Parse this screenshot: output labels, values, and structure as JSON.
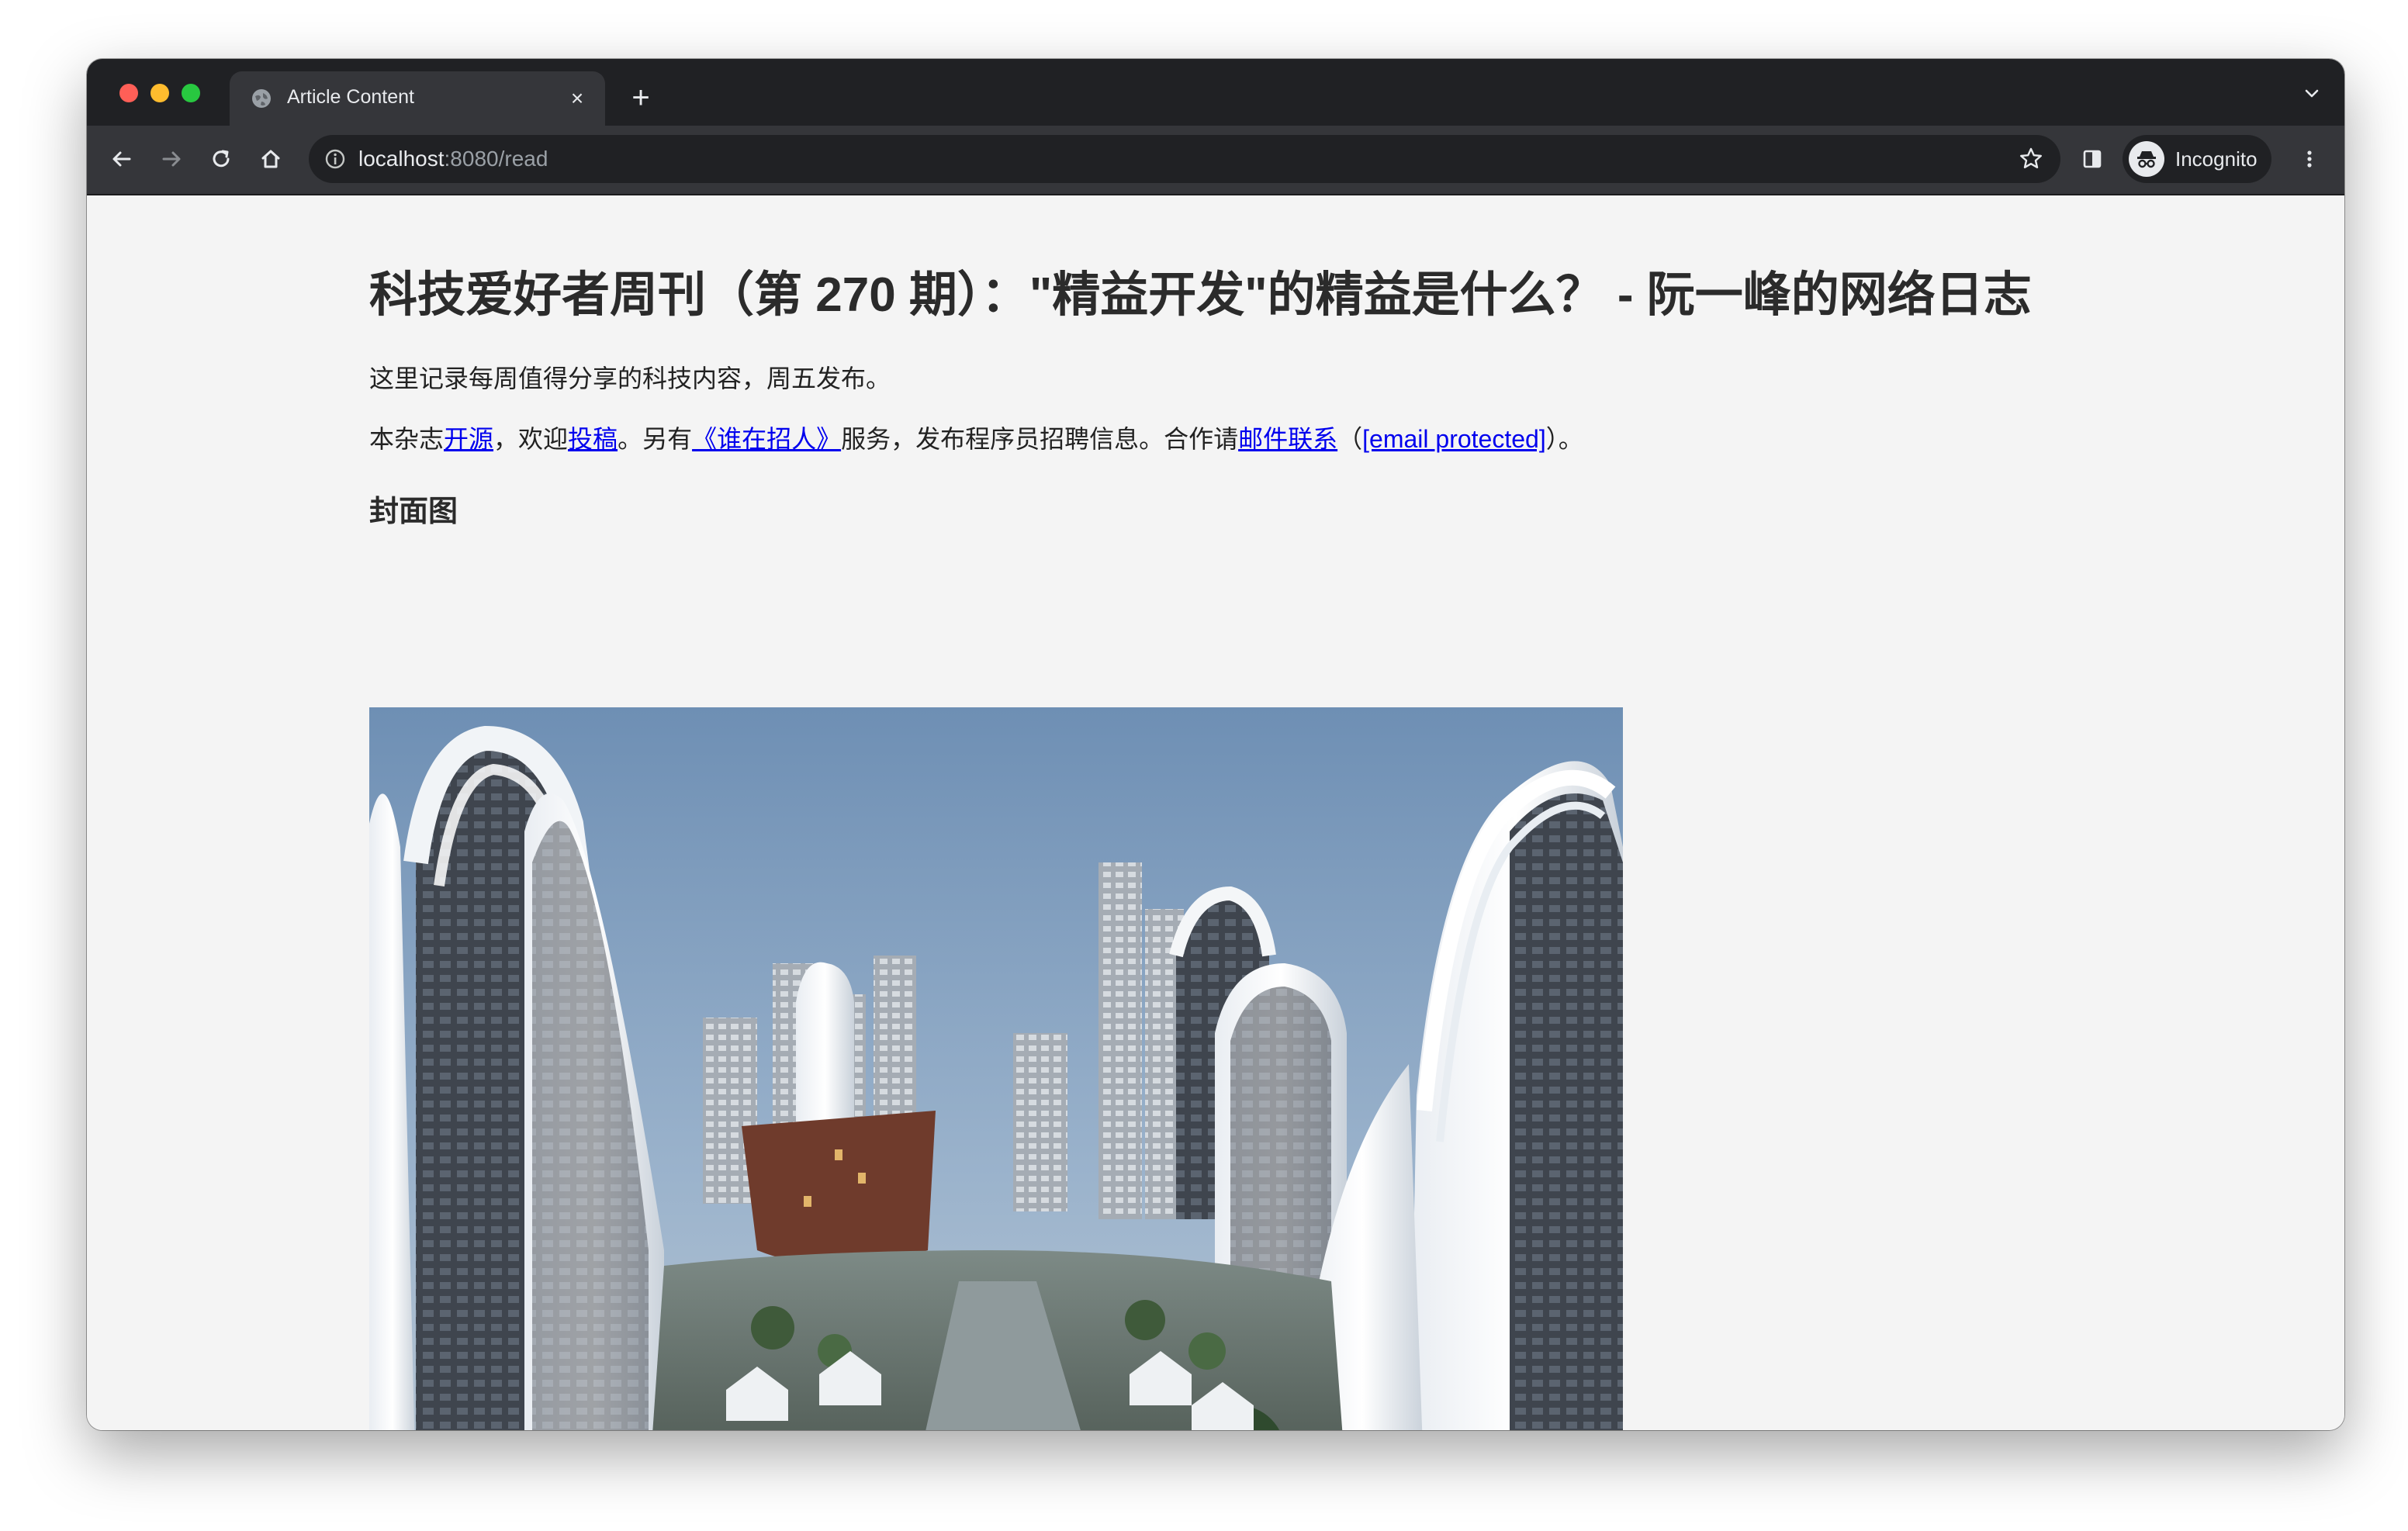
{
  "browser": {
    "tab_title": "Article Content",
    "tab_close_label": "×",
    "new_tab_label": "+",
    "url_host": "localhost",
    "url_rest": ":8080/read",
    "profile_label": "Incognito"
  },
  "article": {
    "title": "科技爱好者周刊（第 270 期）：\"精益开发\"的精益是什么？ - 阮一峰的网络日志",
    "intro": "这里记录每周值得分享的科技内容，周五发布。",
    "promo": {
      "t1": "本杂志",
      "link_open_source": "开源",
      "t2": "，欢迎",
      "link_submit": "投稿",
      "t3": "。另有",
      "link_hiring": "《谁在招人》",
      "t4": "服务，发布程序员招聘信息。合作请",
      "link_email_contact": "邮件联系",
      "t5": "（",
      "link_email": "[email protected]",
      "t6": "）。"
    },
    "cover_heading": "封面图"
  },
  "icons": {
    "favicon": "globe-icon",
    "back": "arrow-left-icon",
    "forward": "arrow-right-icon",
    "reload": "reload-icon",
    "home": "home-icon",
    "info": "info-icon",
    "bookmark": "star-icon",
    "sidepanel": "side-panel-icon",
    "incognito": "incognito-icon",
    "menu": "kebab-menu-icon",
    "tab_search": "chevron-down-icon"
  },
  "colors": {
    "chrome_dark": "#202124",
    "chrome_toolbar": "#35363a",
    "page_bg": "#f4f4f4",
    "link": "#0000ee"
  }
}
